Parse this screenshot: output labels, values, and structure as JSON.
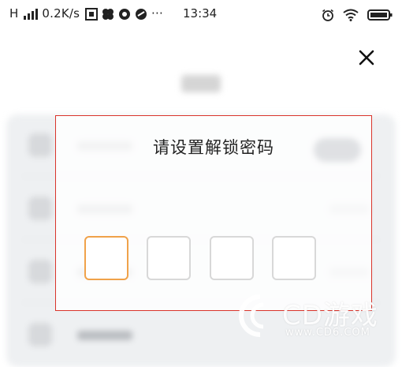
{
  "status_bar": {
    "network": "H",
    "speed": "0.2K/s",
    "more": "···",
    "time": "13:34"
  },
  "dialog": {
    "title": "请设置解锁密码",
    "pin_digits": [
      "",
      "",
      "",
      ""
    ],
    "active_index": 0
  },
  "colors": {
    "highlight_border": "#d9342b",
    "active_box": "#f0a24a",
    "box_border": "#d8d8d8"
  },
  "watermark": {
    "brand": "CD游戏",
    "url": "www.CD6.COM"
  },
  "icons": [
    "signal-icon",
    "app-icon",
    "alarm-icon",
    "wifi-icon",
    "battery-icon",
    "close-icon"
  ]
}
